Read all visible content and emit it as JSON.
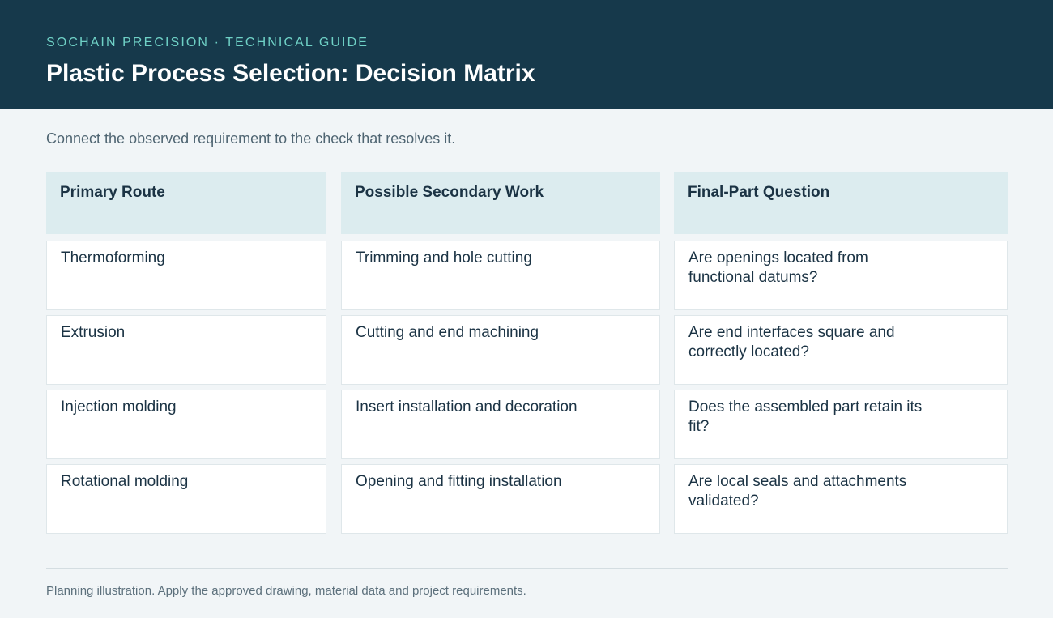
{
  "header": {
    "eyebrow": "SOCHAIN PRECISION · TECHNICAL GUIDE",
    "title": "Plastic Process Selection: Decision Matrix"
  },
  "intro": "Connect the observed requirement to the check that resolves it.",
  "table": {
    "columns": [
      "Primary Route",
      "Possible Secondary Work",
      "Final-Part Question"
    ],
    "rows": [
      [
        "Thermoforming",
        "Trimming and hole cutting",
        "Are openings located from functional datums?"
      ],
      [
        "Extrusion",
        "Cutting and end machining",
        "Are end interfaces square and correctly located?"
      ],
      [
        "Injection molding",
        "Insert installation and decoration",
        "Does the assembled part retain its fit?"
      ],
      [
        "Rotational molding",
        "Opening and fitting installation",
        "Are local seals and attachments validated?"
      ]
    ]
  },
  "footer": "Planning illustration. Apply the approved drawing, material data and project requirements.",
  "colors": {
    "header_bg": "#16394b",
    "accent": "#6fd1c6",
    "head_cell_bg": "#dcecef",
    "page_bg": "#f1f5f7"
  }
}
